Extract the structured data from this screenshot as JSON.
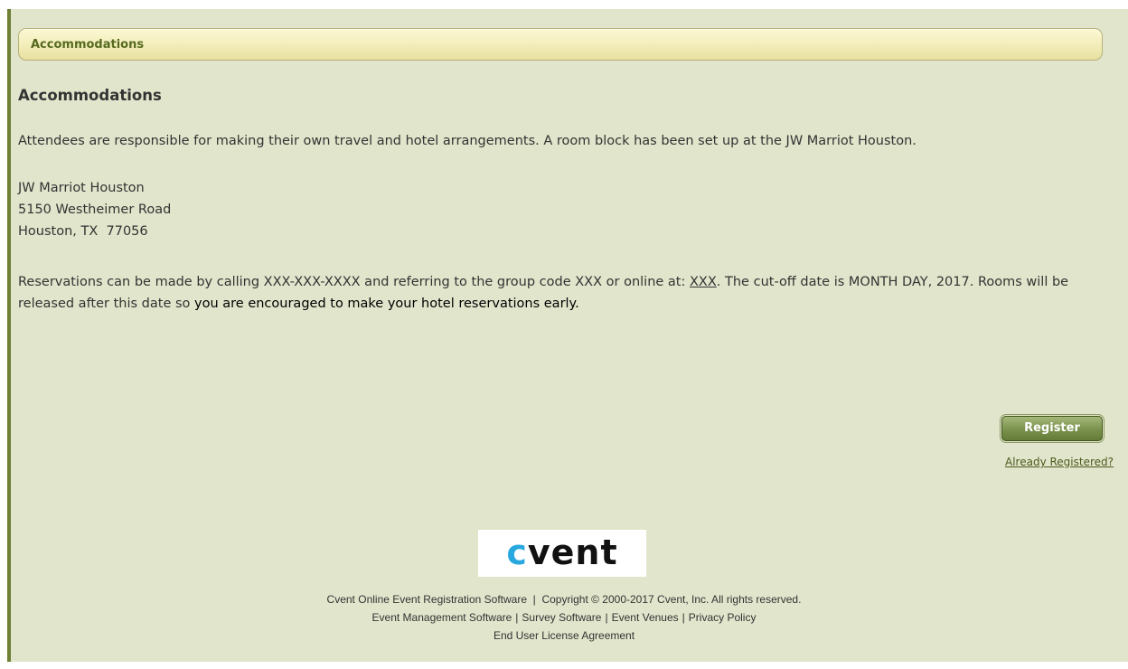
{
  "section_bar": {
    "title": "Accommodations"
  },
  "main": {
    "heading": "Accommodations",
    "intro": "Attendees are responsible for making their own travel and hotel arrangements. A room block has been set up at the JW Marriot Houston.",
    "address": {
      "line1": "JW Marriot Houston",
      "line2": "5150 Westheimer Road",
      "line3": "Houston, TX  77056"
    },
    "reservations": {
      "part1": "Reservations can be made by calling XXX-XXX-XXXX and referring to the group code XXX or online at: ",
      "link": "XXX",
      "part2": ". The cut-off date is MONTH DAY, 2017. Rooms will be released after this date so ",
      "emphasis": "you are encouraged to make your hotel reservations early."
    }
  },
  "actions": {
    "register_label": "Register",
    "already_registered_label": "Already Registered?"
  },
  "logo": {
    "c": "c",
    "rest": "vent",
    "accent_color": "#29a8e0"
  },
  "footer": {
    "line1": "Cvent Online Event Registration Software  |  Copyright © 2000-2017 Cvent, Inc. All rights reserved.",
    "links": [
      "Event Management Software",
      "Survey Software",
      "Event Venues",
      "Privacy Policy"
    ],
    "separator": "|",
    "eula": "End User License Agreement"
  },
  "colors": {
    "page_background": "#e1e5cb",
    "left_border": "#6f7f33",
    "button_green": "#7d9450"
  }
}
